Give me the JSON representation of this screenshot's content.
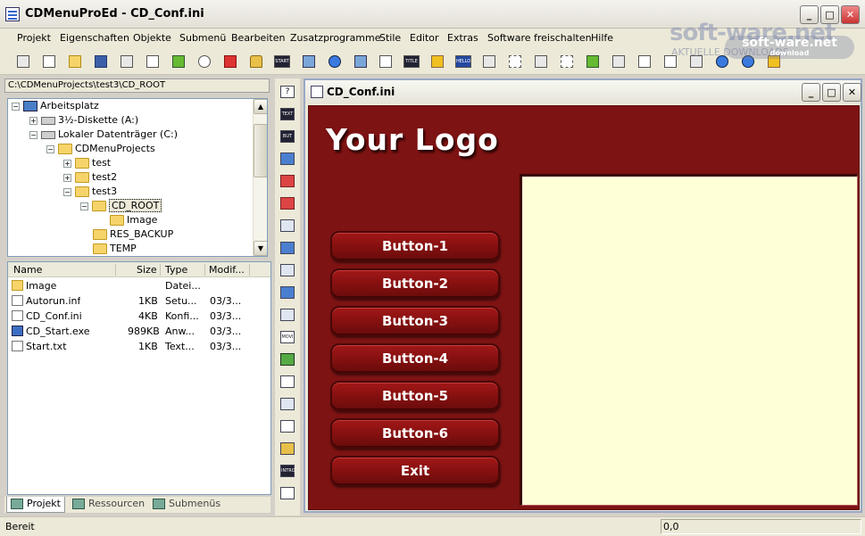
{
  "window": {
    "title": "CDMenuProEd - CD_Conf.ini",
    "min": "_",
    "max": "□",
    "close": "✕"
  },
  "menu": [
    "Projekt",
    "Eigenschaften",
    "Objekte",
    "Submenü",
    "Bearbeiten",
    "Zusatzprogramme",
    "Stile",
    "Editor",
    "Extras",
    "Software freischalten",
    "Hilfe"
  ],
  "watermark": {
    "main": "soft-ware.net",
    "sub": "AKTUELLE DOWNLOADS",
    "badge": "soft-ware.net",
    "badge_sub": "download"
  },
  "toolbar_icons": [
    "wand-icon",
    "new-doc-icon",
    "open-folder-icon",
    "save-icon",
    "print-icon",
    "preview-icon",
    "refresh-icon",
    "undo-icon",
    "cut-red-icon",
    "lock-icon",
    "start-icon",
    "monitor-icon",
    "paint-icon",
    "image-icon",
    "move-icon",
    "title-icon",
    "sound-icon",
    "hello-icon",
    "link-icon",
    "select-icon",
    "frame-icon",
    "crop-icon",
    "zoom-icon",
    "tools-icon",
    "scissors-icon",
    "copy-icon",
    "paste-icon",
    "help-icon",
    "web-icon",
    "home-icon"
  ],
  "path": "C:\\CDMenuProjects\\test3\\CD_ROOT",
  "tree": [
    {
      "label": "Arbeitsplatz",
      "icon": "computer",
      "exp": "−"
    },
    {
      "label": "3½-Diskette (A:)",
      "icon": "drive",
      "exp": "+"
    },
    {
      "label": "Lokaler Datenträger (C:)",
      "icon": "drive",
      "exp": "−"
    },
    {
      "label": "CDMenuProjects",
      "icon": "folder",
      "exp": "−"
    },
    {
      "label": "test",
      "icon": "folder",
      "exp": "+"
    },
    {
      "label": "test2",
      "icon": "folder",
      "exp": "+"
    },
    {
      "label": "test3",
      "icon": "folder",
      "exp": "−"
    },
    {
      "label": "CD_ROOT",
      "icon": "folder",
      "exp": "−"
    },
    {
      "label": "Image",
      "icon": "folder",
      "exp": ""
    },
    {
      "label": "RES_BACKUP",
      "icon": "folder",
      "exp": ""
    },
    {
      "label": "TEMP",
      "icon": "folder",
      "exp": ""
    }
  ],
  "files": {
    "headers": {
      "name": "Name",
      "size": "Size",
      "type": "Type",
      "modified": "Modif..."
    },
    "rows": [
      {
        "name": "Image",
        "size": "",
        "type": "Datei...",
        "modified": "",
        "icon": "folder"
      },
      {
        "name": "Autorun.inf",
        "size": "1KB",
        "type": "Setu...",
        "modified": "03/3...",
        "icon": "file"
      },
      {
        "name": "CD_Conf.ini",
        "size": "4KB",
        "type": "Konfi...",
        "modified": "03/3...",
        "icon": "file"
      },
      {
        "name": "CD_Start.exe",
        "size": "989KB",
        "type": "Anw...",
        "modified": "03/3...",
        "icon": "exe"
      },
      {
        "name": "Start.txt",
        "size": "1KB",
        "type": "Text...",
        "modified": "03/3...",
        "icon": "file"
      }
    ]
  },
  "left_tabs": [
    "Projekt",
    "Ressourcen",
    "Submenüs"
  ],
  "vtoolbar_icons": [
    "help-icon",
    "text-icon",
    "but-icon",
    "window-icon",
    "office-icon",
    "media-icon",
    "monitor-icon",
    "image-icon",
    "frame-icon",
    "grid-icon",
    "movie-icon",
    "tree-icon",
    "slider-icon",
    "panel-icon",
    "list-icon",
    "lock-icon",
    "intro-icon",
    "script-icon"
  ],
  "child": {
    "title": "CD_Conf.ini"
  },
  "canvas": {
    "logo": "Your Logo",
    "buttons": [
      "Button-1",
      "Button-2",
      "Button-3",
      "Button-4",
      "Button-5",
      "Button-6",
      "Exit"
    ],
    "colors": {
      "background": "#7d1313",
      "content": "#ffffd7",
      "button": "#861010"
    }
  },
  "status": {
    "text": "Bereit",
    "coords": "0,0"
  }
}
